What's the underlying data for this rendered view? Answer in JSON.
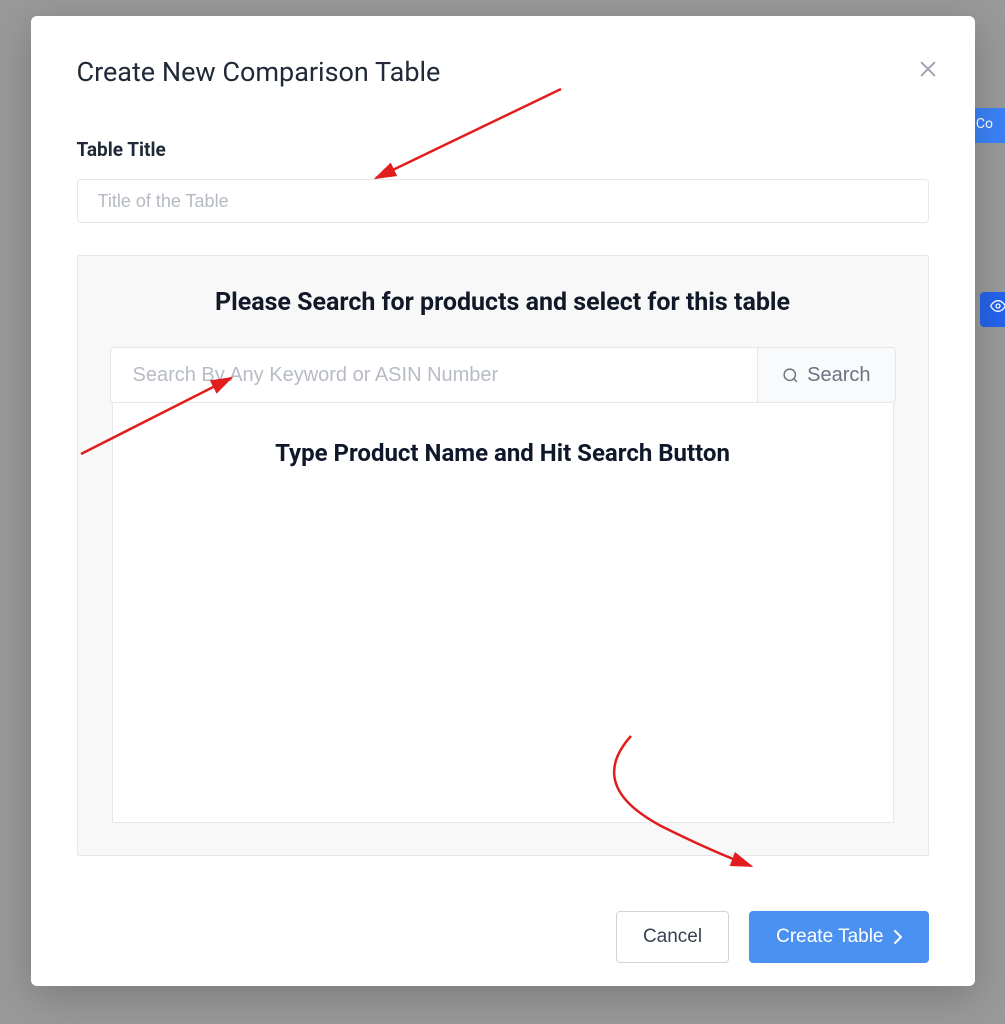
{
  "modal": {
    "title": "Create New Comparison Table",
    "table_title_label": "Table Title",
    "table_title_placeholder": "Title of the Table",
    "search_heading": "Please Search for products and select for this table",
    "search_placeholder": "Search By Any Keyword or ASIN Number",
    "search_button_label": "Search",
    "results_hint": "Type Product Name and Hit Search Button"
  },
  "footer": {
    "cancel_label": "Cancel",
    "create_label": "Create Table"
  },
  "background": {
    "partial_button": "Co"
  }
}
